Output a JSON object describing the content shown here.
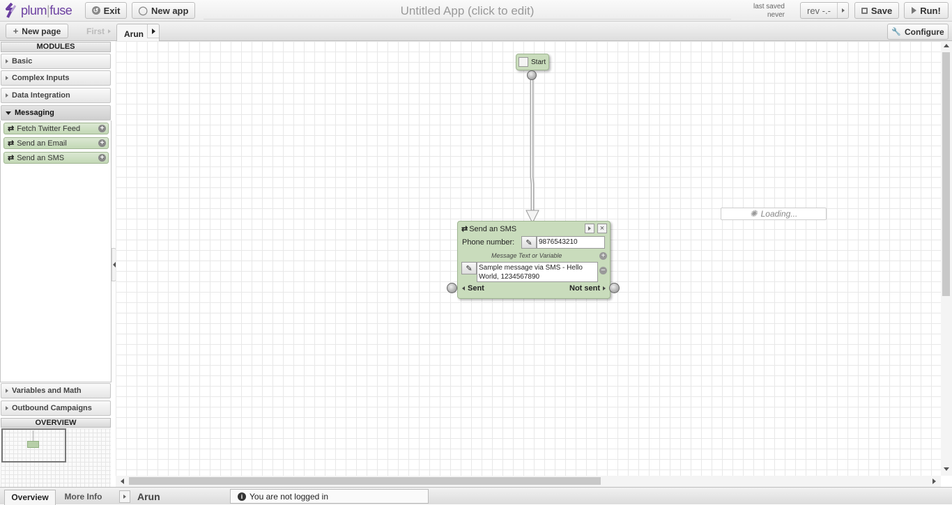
{
  "header": {
    "logo_text_a": "plum",
    "logo_text_b": "fuse",
    "exit_label": "Exit",
    "new_app_label": "New app",
    "app_title": "Untitled App (click to edit)",
    "last_saved_label": "last saved",
    "last_saved_value": "never",
    "rev_label": "rev -.-",
    "save_label": "Save",
    "run_label": "Run!"
  },
  "tabbar": {
    "new_page_label": "New page",
    "first_label": "First",
    "active_tab": "Arun",
    "configure_label": "Configure"
  },
  "sidebar": {
    "modules_header": "MODULES",
    "sections_top": [
      "Basic",
      "Complex Inputs",
      "Data Integration"
    ],
    "messaging_label": "Messaging",
    "messaging_items": [
      "Fetch Twitter Feed",
      "Send an Email",
      "Send an SMS"
    ],
    "sections_bottom": [
      "Variables and Math",
      "Outbound Campaigns"
    ],
    "overview_header": "OVERVIEW"
  },
  "canvas": {
    "start_label": "Start",
    "loading_label": "Loading...",
    "sms_node": {
      "title": "Send an SMS",
      "phone_label": "Phone number:",
      "phone_value": "9876543210",
      "message_hint": "Message Text or Variable",
      "message_value": "Sample message via SMS - Hello World, 1234567890",
      "sent_label": "Sent",
      "not_sent_label": "Not sent"
    }
  },
  "status": {
    "overview_tab": "Overview",
    "more_info_tab": "More Info",
    "page_name": "Arun",
    "login_status": "You are not logged in"
  },
  "colors": {
    "node_green": "#c9dcbc",
    "module_green": "#c3d8b6",
    "logo_purple": "#6b3fa0"
  }
}
